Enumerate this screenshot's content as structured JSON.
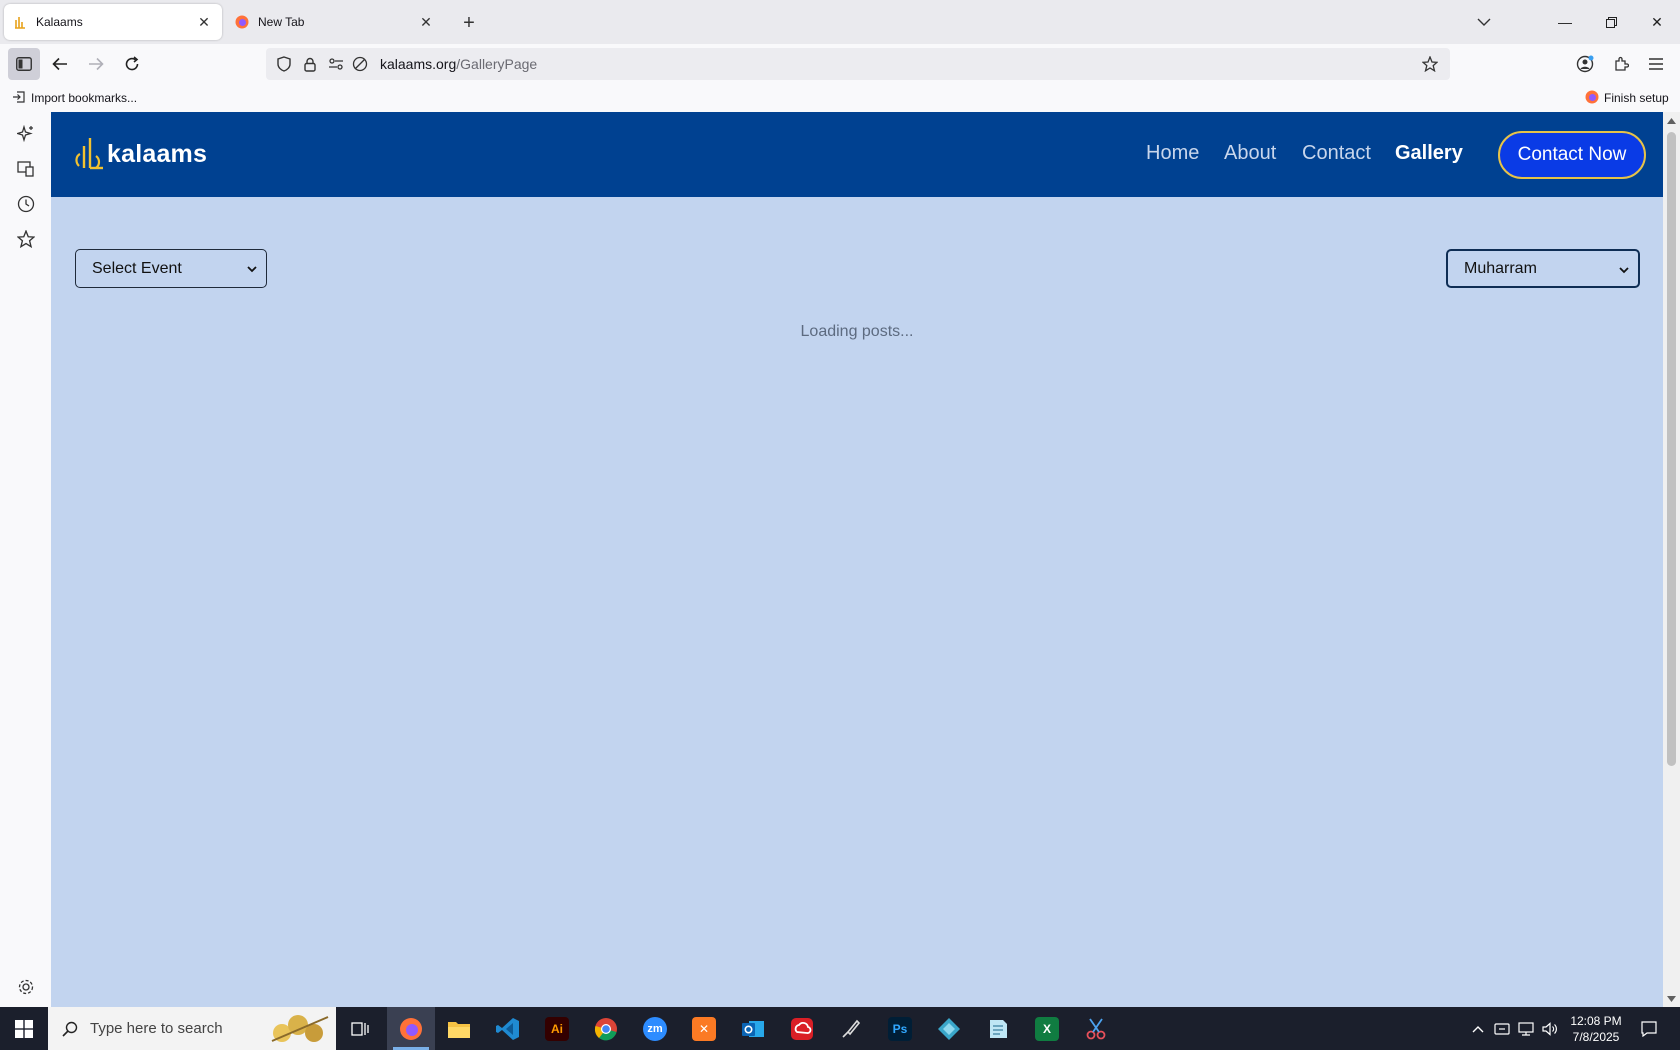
{
  "browser": {
    "tabs": [
      {
        "title": "Kalaams",
        "active": true
      },
      {
        "title": "New Tab",
        "active": false
      }
    ],
    "url": {
      "domain": "kalaams.org",
      "path": "/GalleryPage"
    },
    "bookmarks": {
      "import_label": "Import bookmarks...",
      "finish_setup_label": "Finish setup"
    }
  },
  "site": {
    "logo_text": "kalaams",
    "nav": [
      {
        "label": "Home",
        "active": false
      },
      {
        "label": "About",
        "active": false
      },
      {
        "label": "Contact",
        "active": false
      },
      {
        "label": "Gallery",
        "active": true
      }
    ],
    "contact_button": "Contact Now",
    "event_select": {
      "selected": "Select Event"
    },
    "category_select": {
      "selected": "Muharram"
    },
    "loading_text": "Loading posts..."
  },
  "taskbar": {
    "search_placeholder": "Type here to search",
    "clock": {
      "time": "12:08 PM",
      "date": "7/8/2025"
    },
    "apps": [
      "task-view",
      "firefox",
      "file-explorer",
      "vscode",
      "illustrator",
      "chrome",
      "zoom",
      "xampp",
      "outlook",
      "creative-cloud",
      "pen-tool",
      "photoshop",
      "app-diamond",
      "app-notepad",
      "excel",
      "snipping-tool"
    ]
  },
  "colors": {
    "header": "#004191",
    "page_bg": "#c2d4ef",
    "accent_button": "#0a3be6",
    "button_border": "#e6c349"
  }
}
